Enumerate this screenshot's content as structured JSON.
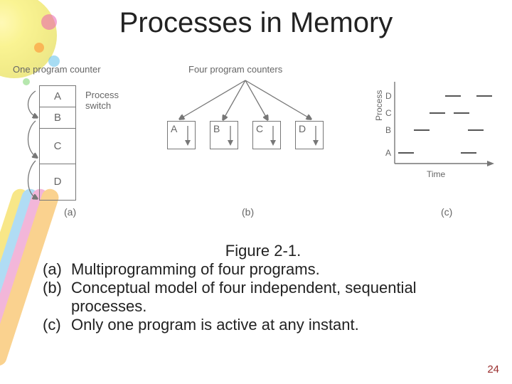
{
  "title": "Processes in Memory",
  "pageNumber": "24",
  "diagram": {
    "a": {
      "header": "One program counter",
      "switchLabel": "Process\nswitch",
      "cells": [
        "A",
        "B",
        "C",
        "D"
      ],
      "sublabel": "(a)"
    },
    "b": {
      "header": "Four program counters",
      "boxes": [
        "A",
        "B",
        "C",
        "D"
      ],
      "sublabel": "(b)"
    },
    "c": {
      "ylabel": "Process",
      "xlabel": "Time",
      "rows": [
        "D",
        "C",
        "B",
        "A"
      ],
      "sublabel": "(c)"
    }
  },
  "caption": {
    "figLabel": "Figure 2-1.",
    "items": [
      {
        "tag": "(a)",
        "text": "Multiprogramming of four programs."
      },
      {
        "tag": "(b)",
        "text": "Conceptual model of four independent, sequential processes."
      },
      {
        "tag": "(c)",
        "text": "Only one program is active at any instant."
      }
    ]
  }
}
